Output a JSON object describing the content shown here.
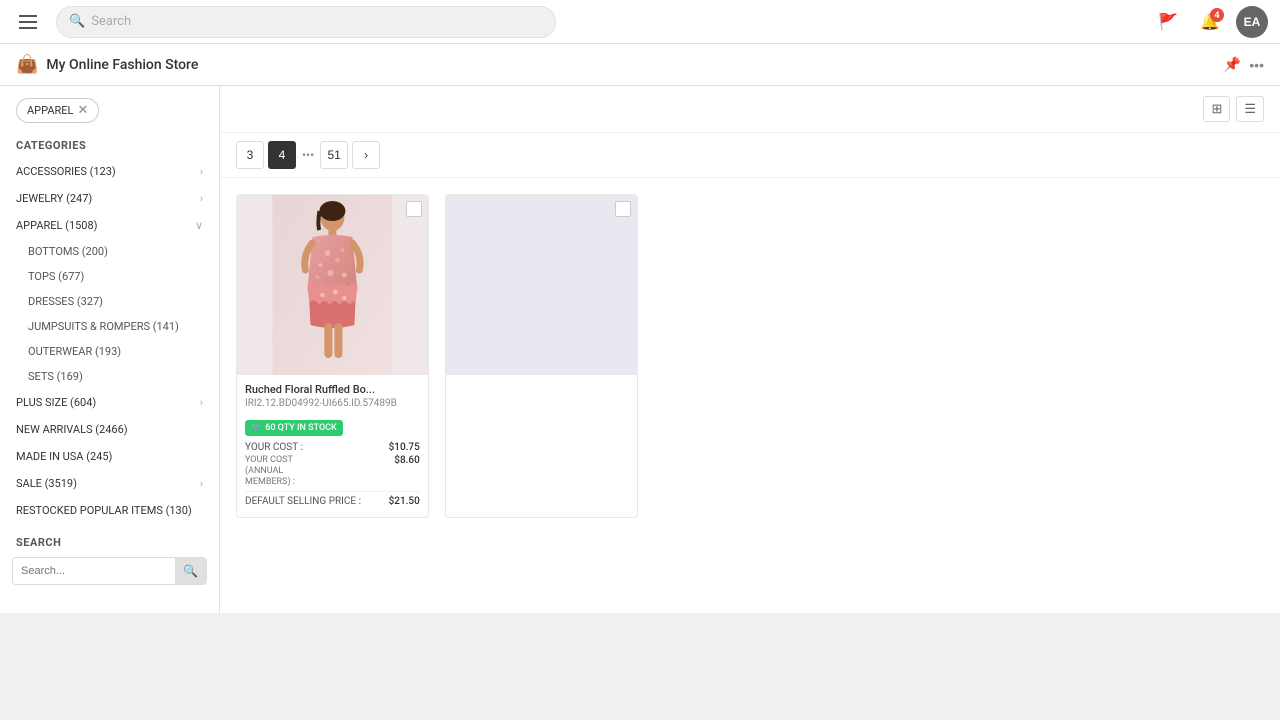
{
  "browser": {
    "address": "myonlinefashionstore.com/apparel"
  },
  "topNav": {
    "menu_label": "☰",
    "search_placeholder": "Search",
    "flag_icon": "🚩",
    "notifications_count": "4",
    "avatar_text": "EA"
  },
  "storeBar": {
    "store_icon": "👜",
    "store_name": "My Online Fashion Store",
    "pin_icon": "📌",
    "more_icon": "•••"
  },
  "sidebar": {
    "active_filter": "APPAREL",
    "categories_title": "CATEGORIES",
    "categories": [
      {
        "id": "accessories",
        "label": "ACCESSORIES (123)",
        "hasChildren": false,
        "expanded": false
      },
      {
        "id": "jewelry",
        "label": "JEWELRY (247)",
        "hasChildren": false,
        "expanded": false
      },
      {
        "id": "apparel",
        "label": "APPAREL (1508)",
        "hasChildren": true,
        "expanded": true
      },
      {
        "id": "plus-size",
        "label": "PLUS SIZE (604)",
        "hasChildren": false,
        "expanded": false
      },
      {
        "id": "new-arrivals",
        "label": "NEW ARRIVALS (2466)",
        "hasChildren": false,
        "expanded": false
      },
      {
        "id": "made-in-usa",
        "label": "MADE IN USA (245)",
        "hasChildren": false,
        "expanded": false
      },
      {
        "id": "sale",
        "label": "SALE (3519)",
        "hasChildren": false,
        "expanded": false
      },
      {
        "id": "restocked",
        "label": "RESTOCKED POPULAR ITEMS (130)",
        "hasChildren": false,
        "expanded": false
      }
    ],
    "subcategories": [
      {
        "id": "bottoms",
        "label": "BOTTOMS (200)"
      },
      {
        "id": "tops",
        "label": "TOPS (677)"
      },
      {
        "id": "dresses",
        "label": "DRESSES (327)"
      },
      {
        "id": "jumpsuits",
        "label": "JUMPSUITS & ROMPERS (141)"
      },
      {
        "id": "outerwear",
        "label": "OUTERWEAR (193)"
      },
      {
        "id": "sets",
        "label": "SETS (169)"
      }
    ],
    "search_section_title": "SEARCH",
    "search_placeholder": "Search..."
  },
  "pagination": {
    "pages": [
      "3",
      "4",
      "51"
    ],
    "active_page": "4",
    "next_label": "›"
  },
  "product": {
    "name": "Ruched Floral Ruffled Bo...",
    "sku": "IRI2.12.BD04992-UI665.ID.57489B",
    "stock_qty": "60",
    "stock_label": "60 QTY IN STOCK",
    "your_cost_label": "YOUR COST :",
    "your_cost_value": "$10.75",
    "annual_cost_label": "YOUR COST (ANNUAL MEMBERS) :",
    "annual_cost_value": "$8.60",
    "selling_price_label": "DEFAULT SELLING PRICE :",
    "selling_price_value": "$21.50"
  },
  "viewControls": {
    "grid_icon": "⊞",
    "list_icon": "☰"
  }
}
